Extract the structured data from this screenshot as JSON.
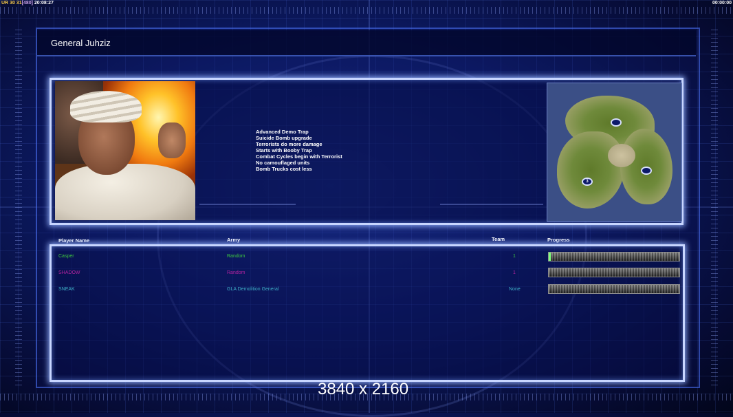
{
  "status_bar": {
    "left_a": "UR",
    "left_b": "30 31",
    "left_c": "[480]",
    "left_d": "20:08:27",
    "right_time": "00:00:00"
  },
  "window": {
    "title": "General Juhziz"
  },
  "general": {
    "bonuses": [
      "Advanced Demo Trap",
      "Suicide Bomb upgrade",
      "Terrorists do more damage",
      "Starts with Booby Trap",
      "Combat Cycles begin with Terrorist",
      "No camouflaged units",
      "Bomb Trucks cost less"
    ]
  },
  "minimap": {
    "spawn_label": "3"
  },
  "players_table": {
    "headers": {
      "player_name": "Player Name",
      "army": "Army",
      "team": "Team",
      "progress": "Progress"
    },
    "rows": [
      {
        "name": "Casper",
        "army": "Random",
        "team": "1",
        "progress": 0.01,
        "color": "#3dc93d"
      },
      {
        "name": "SHADOW",
        "army": "Random",
        "team": "1",
        "progress": 0.0,
        "color": "#b3239f"
      },
      {
        "name": "SNEAK",
        "army": "GLA Demolition General",
        "team": "None",
        "progress": 0.0,
        "color": "#3fb0c9"
      }
    ]
  },
  "overlay": {
    "resolution": "3840 x 2160"
  }
}
